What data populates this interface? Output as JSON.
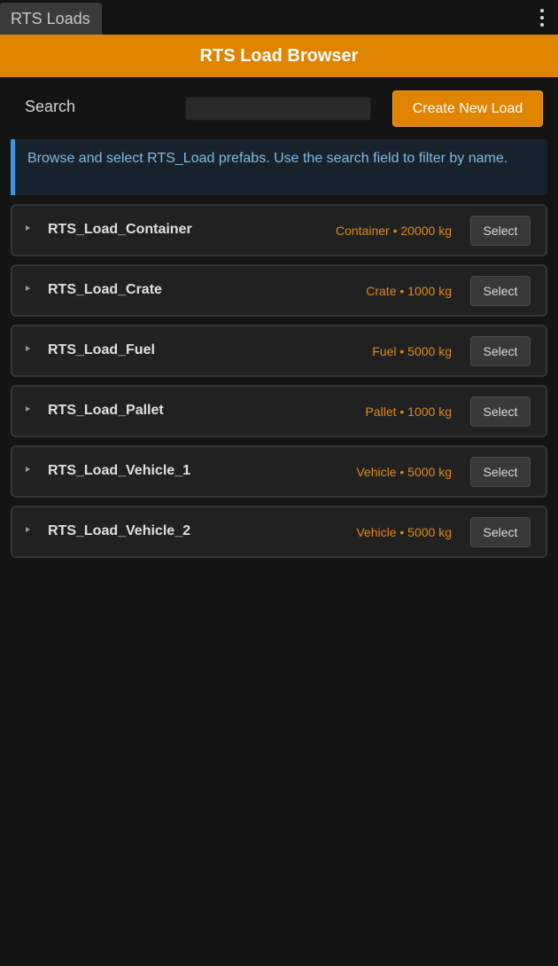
{
  "tab": {
    "label": "RTS Loads"
  },
  "header": {
    "title": "RTS Load Browser"
  },
  "search": {
    "label": "Search",
    "value": "",
    "placeholder": ""
  },
  "toolbar": {
    "create_label": "Create New Load"
  },
  "info": {
    "text": "Browse and select RTS_Load prefabs. Use the search field to filter by name."
  },
  "colors": {
    "accent": "#e08400",
    "info_border": "#3c96dc",
    "info_text": "#7fbde6",
    "meta_text": "#e08a1a"
  },
  "loads": [
    {
      "name": "RTS_Load_Container",
      "meta": "Container • 20000 kg",
      "select_label": "Select"
    },
    {
      "name": "RTS_Load_Crate",
      "meta": "Crate • 1000 kg",
      "select_label": "Select"
    },
    {
      "name": "RTS_Load_Fuel",
      "meta": "Fuel • 5000 kg",
      "select_label": "Select"
    },
    {
      "name": "RTS_Load_Pallet",
      "meta": "Pallet • 1000 kg",
      "select_label": "Select"
    },
    {
      "name": "RTS_Load_Vehicle_1",
      "meta": "Vehicle • 5000 kg",
      "select_label": "Select"
    },
    {
      "name": "RTS_Load_Vehicle_2",
      "meta": "Vehicle • 5000 kg",
      "select_label": "Select"
    }
  ]
}
